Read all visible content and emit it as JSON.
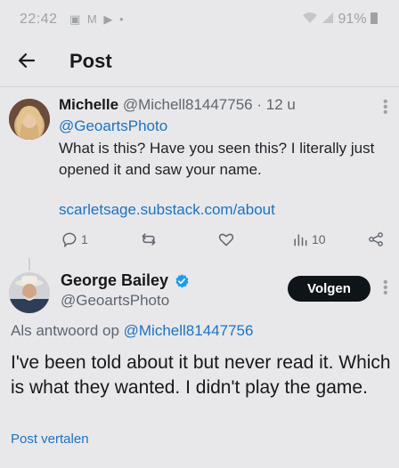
{
  "status_bar": {
    "time": "22:42",
    "left_icons": "▣ M ▶ •",
    "battery": "91%"
  },
  "header": {
    "title": "Post"
  },
  "tweet1": {
    "name": "Michelle",
    "handle": "@Michell81447756",
    "time": "· 12 u",
    "mention": "@GeoartsPhoto",
    "body": "What is this?  Have you seen this?  I literally just opened it and saw your name.",
    "url": "scarletsage.substack.com/about",
    "reply_count": "1",
    "views_count": "10"
  },
  "tweet2": {
    "name": "George Bailey",
    "handle": "@GeoartsPhoto",
    "follow_label": "Volgen",
    "reply_prefix": "Als antwoord op",
    "reply_target": "@Michell81447756",
    "body": "I've been told about it but never read it. Which is what they wanted.  I didn't play the game.",
    "translate_label": "Post vertalen"
  },
  "colors": {
    "background": "#e8e8ea",
    "link": "#1d73bf",
    "verified": "#1d9bf0",
    "button": "#0f1419"
  }
}
